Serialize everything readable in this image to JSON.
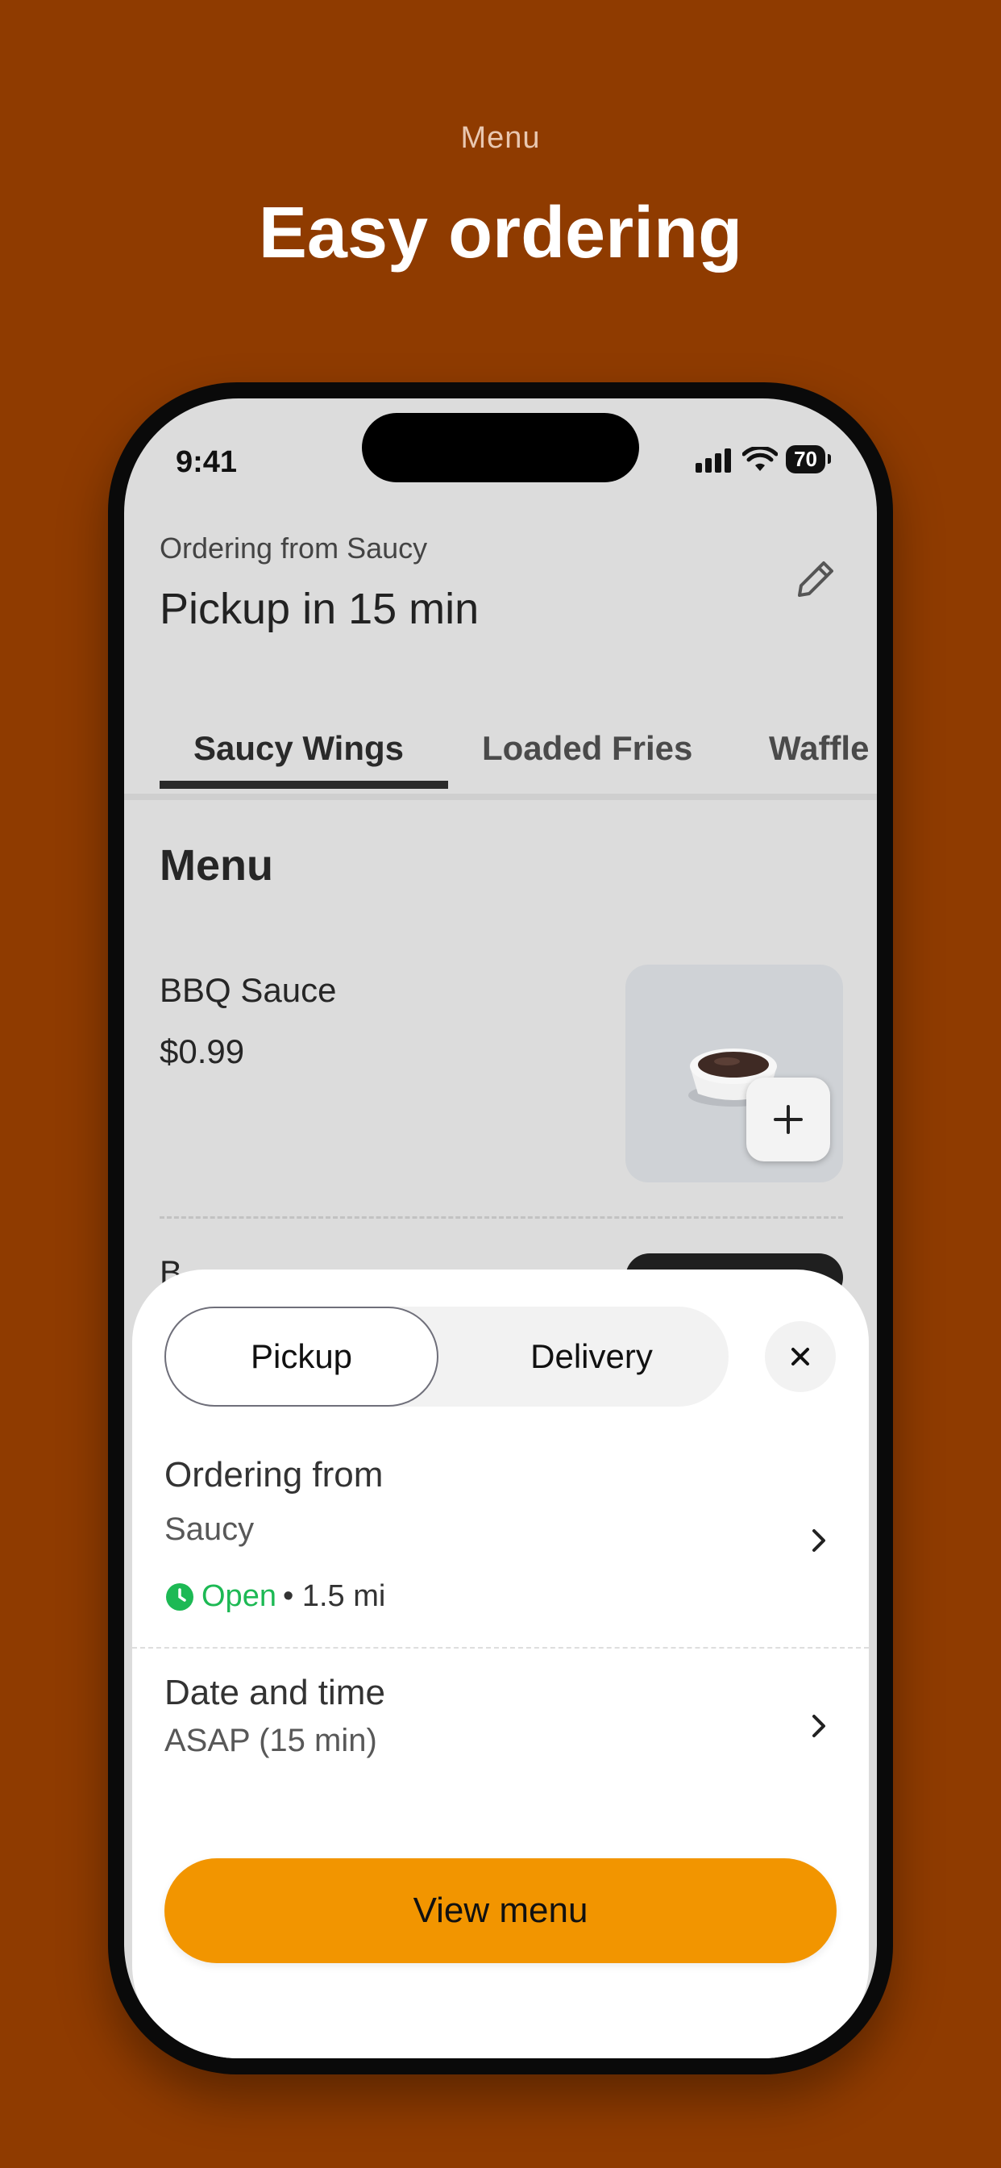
{
  "header": {
    "eyebrow": "Menu",
    "title": "Easy ordering"
  },
  "status_bar": {
    "time": "9:41",
    "battery": "70"
  },
  "ordering": {
    "subtitle": "Ordering from Saucy",
    "title": "Pickup in 15 min"
  },
  "tabs": [
    {
      "label": "Saucy Wings",
      "active": true
    },
    {
      "label": "Loaded Fries",
      "active": false
    },
    {
      "label": "Waffle",
      "active": false
    }
  ],
  "menu": {
    "heading": "Menu",
    "items": [
      {
        "name": "BBQ Sauce",
        "price": "$0.99"
      }
    ],
    "peek_text": "B"
  },
  "sheet": {
    "segment": {
      "pickup": "Pickup",
      "delivery": "Delivery",
      "selected": "Pickup"
    },
    "ordering_from": {
      "title": "Ordering from",
      "store": "Saucy",
      "status": "Open",
      "distance": "• 1.5 mi"
    },
    "date_time": {
      "title": "Date and time",
      "value": "ASAP (15 min)"
    },
    "cta": "View menu"
  },
  "colors": {
    "background": "#8f3b00",
    "accent": "#f29500",
    "open_green": "#1db954"
  },
  "icons": [
    "pencil-icon",
    "plus-icon",
    "close-icon",
    "chevron-right-icon",
    "clock-icon",
    "signal-icon",
    "wifi-icon",
    "battery-icon"
  ]
}
